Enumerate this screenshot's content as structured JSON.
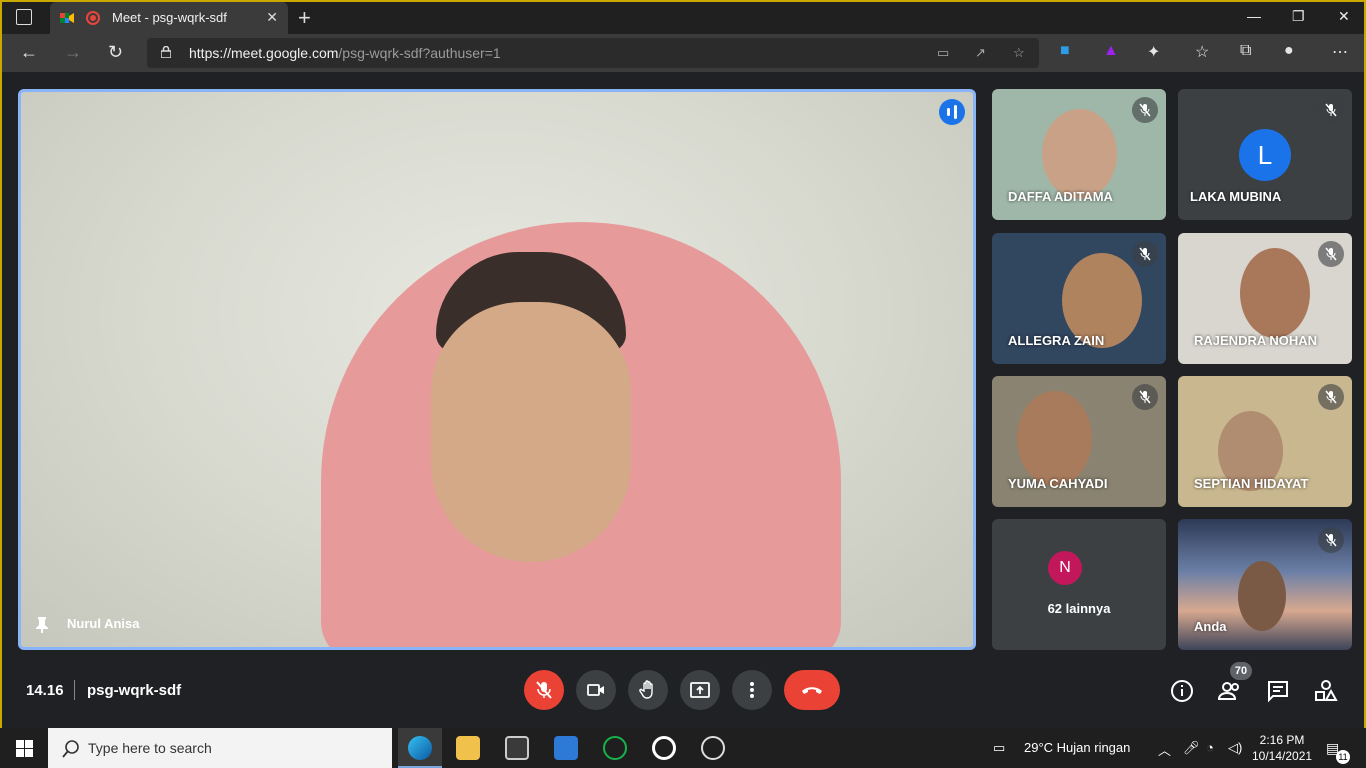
{
  "browser": {
    "tab_title": "Meet - psg-wqrk-sdf",
    "url_host": "https://meet.google.com",
    "url_path": "/psg-wqrk-sdf?authuser=1"
  },
  "meet": {
    "main_speaker": "Nurul Anisa",
    "tiles": [
      {
        "name": "DAFFA ADITAMA",
        "muted": true
      },
      {
        "name": "LAKA MUBINA",
        "muted": true,
        "avatar_letter": "L"
      },
      {
        "name": "ALLEGRA ZAIN",
        "muted": true
      },
      {
        "name": "RAJENDRA NOHAN",
        "muted": true
      },
      {
        "name": "YUMA CAHYADI",
        "muted": true
      },
      {
        "name": "SEPTIAN HIDAYAT",
        "muted": true
      },
      {
        "name": "62 lainnya",
        "avatar_letter": "N"
      },
      {
        "name": "Anda",
        "muted": true
      }
    ],
    "time": "14.16",
    "meeting_code": "psg-wqrk-sdf",
    "participants_count": "70"
  },
  "taskbar": {
    "search_placeholder": "Type here to search",
    "weather": "29°C  Hujan ringan",
    "time": "2:16 PM",
    "date": "10/14/2021",
    "notification_count": "11"
  },
  "colors": {
    "meet_bg": "#202124",
    "accent_blue": "#1a73e8",
    "red": "#ea4335",
    "frame_yellow": "#c9a800"
  }
}
